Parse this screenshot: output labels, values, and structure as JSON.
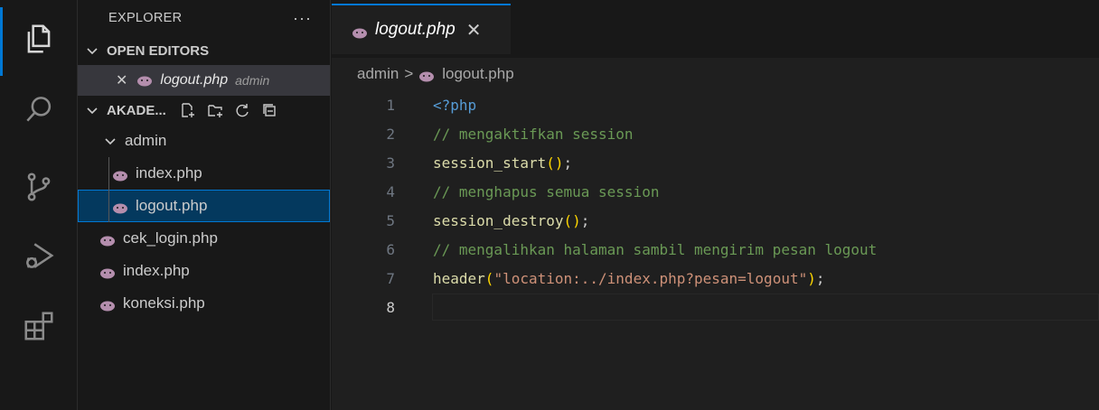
{
  "activity_bar": {
    "icons": [
      "explorer-icon",
      "search-icon",
      "source-control-icon",
      "run-debug-icon",
      "extensions-icon"
    ]
  },
  "sidebar": {
    "title": "EXPLORER",
    "more_label": "···",
    "open_editors": {
      "label": "OPEN EDITORS",
      "items": [
        {
          "close": "✕",
          "name": "logout.php",
          "dir": "admin"
        }
      ]
    },
    "workspace": {
      "label": "AKADE...",
      "tree": {
        "folder": "admin",
        "children": [
          "index.php",
          "logout.php"
        ],
        "root_files": [
          "cek_login.php",
          "index.php",
          "koneksi.php"
        ]
      }
    }
  },
  "editor": {
    "tab": {
      "name": "logout.php",
      "close": "✕"
    },
    "breadcrumb": {
      "folder": "admin",
      "separator": ">",
      "file": "logout.php"
    },
    "lines": [
      {
        "num": "1",
        "tokens": [
          {
            "t": "<?php",
            "c": "kw"
          }
        ]
      },
      {
        "num": "2",
        "tokens": [
          {
            "t": "// mengaktifkan session",
            "c": "comment"
          }
        ]
      },
      {
        "num": "3",
        "tokens": [
          {
            "t": "session_start",
            "c": "fn"
          },
          {
            "t": "()",
            "c": "paren"
          },
          {
            "t": ";",
            "c": "punct"
          }
        ]
      },
      {
        "num": "4",
        "tokens": [
          {
            "t": "// menghapus semua session",
            "c": "comment"
          }
        ]
      },
      {
        "num": "5",
        "tokens": [
          {
            "t": "session_destroy",
            "c": "fn"
          },
          {
            "t": "()",
            "c": "paren"
          },
          {
            "t": ";",
            "c": "punct"
          }
        ]
      },
      {
        "num": "6",
        "tokens": [
          {
            "t": "// mengalihkan halaman sambil mengirim pesan logout",
            "c": "comment"
          }
        ]
      },
      {
        "num": "7",
        "tokens": [
          {
            "t": "header",
            "c": "fn"
          },
          {
            "t": "(",
            "c": "paren"
          },
          {
            "t": "\"location:../index.php?pesan=logout\"",
            "c": "str"
          },
          {
            "t": ")",
            "c": "paren"
          },
          {
            "t": ";",
            "c": "punct"
          }
        ]
      },
      {
        "num": "8",
        "tokens": []
      }
    ],
    "current_line": "8"
  },
  "colors": {
    "accent": "#0078d4",
    "php_icon": "#b48ead",
    "comment": "#6a9955",
    "keyword": "#569cd6",
    "function": "#dcdcaa",
    "string": "#ce9178",
    "bracket": "#ffd700"
  }
}
